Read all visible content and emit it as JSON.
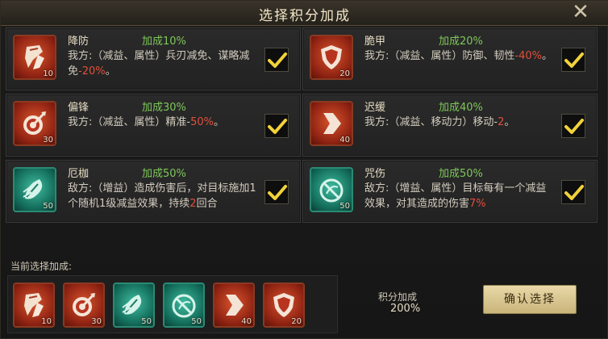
{
  "title": "选择积分加成",
  "close_icon": "close-icon",
  "cards": [
    {
      "name": "降防",
      "bonus": "加成10%",
      "level": "10",
      "icon": "shattered-armor-icon",
      "style": "red",
      "desc_prefix": "我方:（减益、属性）兵刃减免、谋略减免",
      "desc_neg": "-20%",
      "desc_suffix": "。",
      "checked": true
    },
    {
      "name": "脆甲",
      "bonus": "加成20%",
      "level": "20",
      "icon": "broken-shield-icon",
      "style": "red",
      "desc_prefix": "我方:（减益、属性）防御、韧性",
      "desc_neg": "-40%",
      "desc_suffix": "。",
      "checked": true
    },
    {
      "name": "偏锋",
      "bonus": "加成30%",
      "level": "30",
      "icon": "target-arrow-icon",
      "style": "red",
      "desc_prefix": "我方:（减益、属性）精准-",
      "desc_neg": "50%",
      "desc_suffix": "。",
      "checked": true
    },
    {
      "name": "迟缓",
      "bonus": "加成40%",
      "level": "40",
      "icon": "slow-arrow-icon",
      "style": "red",
      "desc_prefix": "我方:（减益、移动力）移动-",
      "desc_neg": "2",
      "desc_suffix": "。",
      "checked": true
    },
    {
      "name": "厄枷",
      "bonus": "加成50%",
      "level": "50",
      "icon": "leaf-curse-icon",
      "style": "teal",
      "desc_prefix": "敌方:（增益）造成伤害后，对目标施加1个随机1级减益效果，持续",
      "desc_neg": "2",
      "desc_suffix": "回合",
      "checked": true
    },
    {
      "name": "咒伤",
      "bonus": "加成50%",
      "level": "50",
      "icon": "cursed-wound-icon",
      "style": "teal",
      "desc_prefix": "敌方:（增益、属性）目标每有一个减益效果，对其造成的伤害",
      "desc_neg": "7%",
      "desc_suffix": "",
      "checked": true
    }
  ],
  "bottom": {
    "current_label": "当前选择加成:",
    "selected": [
      {
        "icon": "shattered-armor-icon",
        "style": "red",
        "level": "10"
      },
      {
        "icon": "target-arrow-icon",
        "style": "red",
        "level": "30"
      },
      {
        "icon": "leaf-curse-icon",
        "style": "teal",
        "level": "50"
      },
      {
        "icon": "cursed-wound-icon",
        "style": "teal",
        "level": "50"
      },
      {
        "icon": "slow-arrow-icon",
        "style": "red",
        "level": "40"
      },
      {
        "icon": "broken-shield-icon",
        "style": "red",
        "level": "20"
      }
    ],
    "score_label": "积分加成",
    "score_value": "200%",
    "confirm_label": "确认选择"
  },
  "colors": {
    "bonus_green": "#7ec85a",
    "negative_red": "#e0503c",
    "check_yellow": "#f2d23a"
  }
}
